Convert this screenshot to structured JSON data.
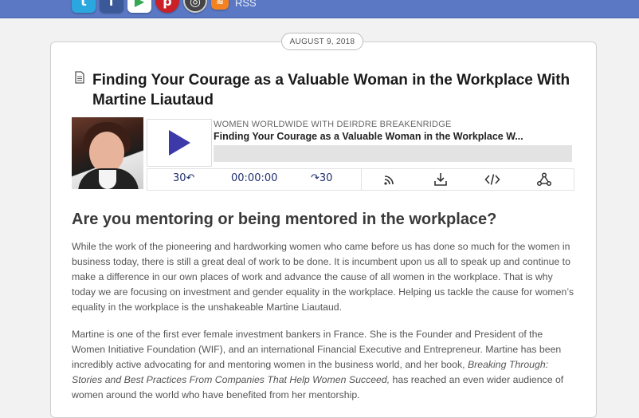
{
  "topbar": {
    "social": [
      {
        "name": "twitter-icon",
        "glyph": "t"
      },
      {
        "name": "facebook-icon",
        "glyph": "f"
      },
      {
        "name": "google-play-icon",
        "glyph": "▶"
      },
      {
        "name": "pinterest-icon",
        "glyph": "p"
      },
      {
        "name": "stitcher-icon",
        "glyph": "◎"
      },
      {
        "name": "rss-icon",
        "glyph": "≋"
      }
    ],
    "rss_label": "RSS"
  },
  "post": {
    "date": "AUGUST 9, 2018",
    "title": "Finding Your Courage as a Valuable Woman in the Workplace With Martine Liautaud"
  },
  "player": {
    "show": "WOMEN WORLDWIDE WITH DEIRDRE BREAKENRIDGE",
    "episode": "Finding Your Courage as a Valuable Woman in the Workplace W...",
    "rewind": "30↶",
    "time": "00:00:00",
    "forward": "↷30",
    "progress": 0,
    "accent": "#3b3aa8"
  },
  "article": {
    "heading": "Are you mentoring or being mentored in the workplace?",
    "p1": "While the work of the pioneering and hardworking women who came before us has done so much for the women in business today, there is still a great deal of work to be done. It is incumbent upon us all to speak up and continue to make a difference in our own places of work and advance the cause of all women in the workplace. That is why today we are focusing on investment and gender equality in the workplace. Helping us tackle the cause for women’s equality in the workplace is the unshakeable Martine Liautaud.",
    "p2_before": "Martine is one of the first ever female investment bankers in France. She is the Founder and President of the Women Initiative Foundation (WIF), and an international Financial Executive and Entrepreneur. Martine has been incredibly active advocating for and mentoring women in the business world, and her book, ",
    "p2_book": "Breaking Through: Stories and Best Practices From Companies That Help Women Succeed,",
    "p2_after": " has reached an even wider audience of women around the world who have benefited from her mentorship."
  }
}
